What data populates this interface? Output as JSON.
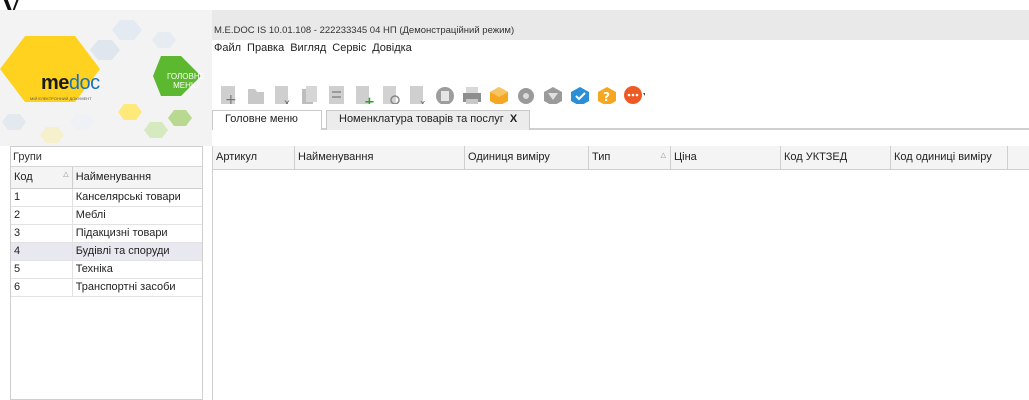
{
  "window": {
    "title": "M.E.DOC IS 10.01.108 - 222233345 04 НП (Демонстраційний режим)"
  },
  "logo": {
    "me": "me",
    "doc": "doc",
    "subtitle": "МІЙ ЕЛЕКТРОННИЙ ДОКУМЕНТ",
    "home_label": "ГОЛОВНЕ МЕНЮ"
  },
  "menu": [
    "Файл",
    "Правка",
    "Вигляд",
    "Сервіс",
    "Довідка"
  ],
  "toolbar_icons": [
    "new-document-icon",
    "open-document-icon",
    "delete-document-icon",
    "copy-icon",
    "edit-icon",
    "add-row-icon",
    "view-icon",
    "remove-row-icon",
    "archive-icon",
    "print-icon",
    "package-icon",
    "settings-icon",
    "filter-icon",
    "shield-icon",
    "help-icon",
    "chat-icon"
  ],
  "tabs": [
    {
      "label": "Головне меню",
      "active": false
    },
    {
      "label": "Номенклатура товарів та послуг",
      "active": true,
      "close": "X"
    }
  ],
  "groups": {
    "title": "Групи",
    "columns": [
      "Код",
      "Найменування"
    ],
    "rows": [
      {
        "code": "1",
        "name": "Канселярські товари"
      },
      {
        "code": "2",
        "name": "Меблі"
      },
      {
        "code": "3",
        "name": "Підакцизні товари"
      },
      {
        "code": "4",
        "name": "Будівлі та споруди"
      },
      {
        "code": "5",
        "name": "Техніка"
      },
      {
        "code": "6",
        "name": "Транспортні засоби"
      }
    ],
    "selected_index": 3
  },
  "main_table": {
    "columns": [
      "Артикул",
      "Найменування",
      "Одиниця виміру",
      "Тип",
      "Ціна",
      "Код УКТЗЕД",
      "Код одиниці виміру"
    ]
  }
}
